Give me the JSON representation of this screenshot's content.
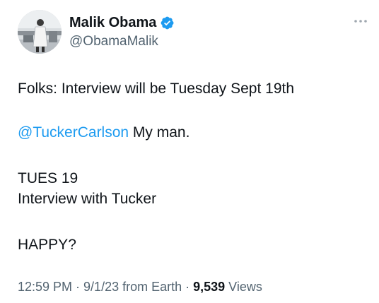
{
  "author": {
    "display_name": "Malik Obama",
    "handle": "@ObamaMalik",
    "verified": true,
    "verified_color": "#1d9bf0"
  },
  "tweet": {
    "line1": "Folks: Interview will be Tuesday Sept 19th",
    "mention": "@TuckerCarlson",
    "line2_rest": " My man.",
    "line3": "TUES 19",
    "line4": "Interview with Tucker",
    "line5": "HAPPY?"
  },
  "meta": {
    "time": "12:59 PM",
    "sep1": " · ",
    "date": "9/1/23",
    "source": " from Earth",
    "sep2": " · ",
    "views_count": "9,539",
    "views_label": " Views"
  },
  "icons": {
    "more": "more-horizontal-icon",
    "verified": "verified-badge-icon"
  },
  "colors": {
    "text": "#0f1419",
    "secondary": "#536471",
    "accent": "#1d9bf0"
  }
}
